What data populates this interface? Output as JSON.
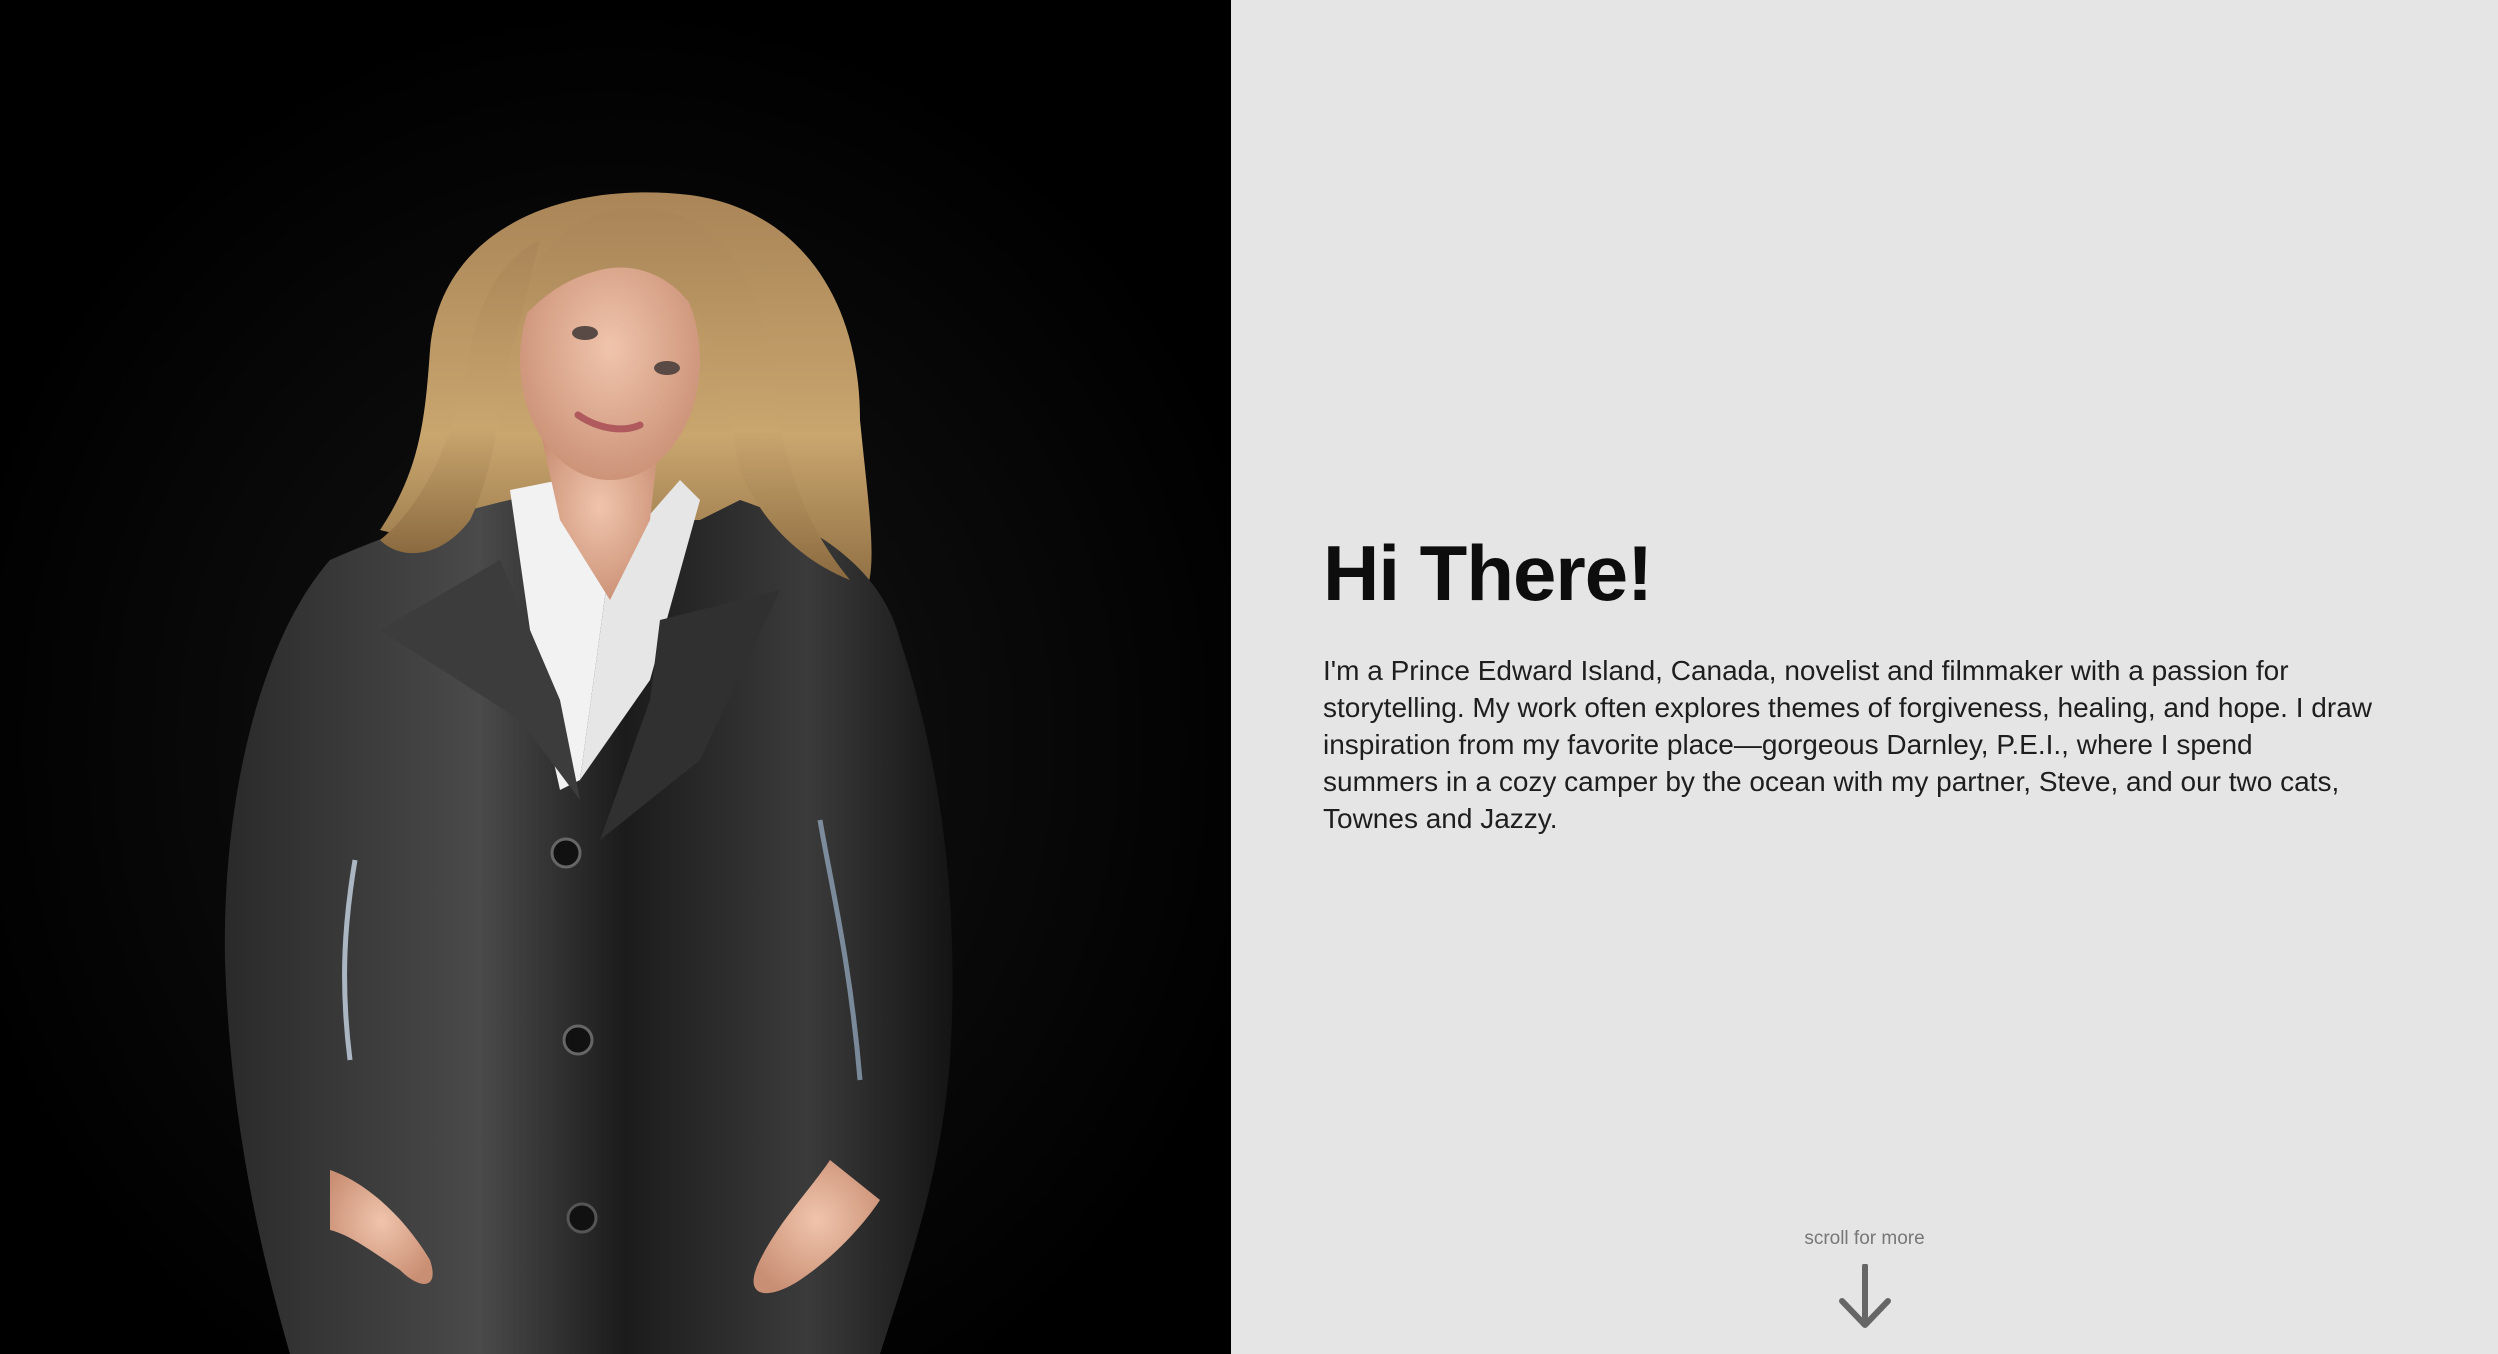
{
  "hero": {
    "portrait_icon": "portrait-photo",
    "heading": "Hi There!",
    "bio": "I'm a Prince Edward Island, Canada, novelist and filmmaker with a passion for storytelling. My work often explores themes of forgiveness, healing, and hope. I draw inspiration from my favorite place—gorgeous Darnley, P.E.I., where I spend summers in a cozy camper by the ocean with my partner, Steve, and our two cats, Townes and Jazzy."
  },
  "scroll": {
    "label": "scroll for more",
    "icon": "arrow-down-icon"
  },
  "colors": {
    "photo_background": "#000000",
    "text_panel_background": "#e5e5e5",
    "heading": "#0d0d0d",
    "body": "#1e1e1e",
    "scroll_hint": "#777777"
  }
}
